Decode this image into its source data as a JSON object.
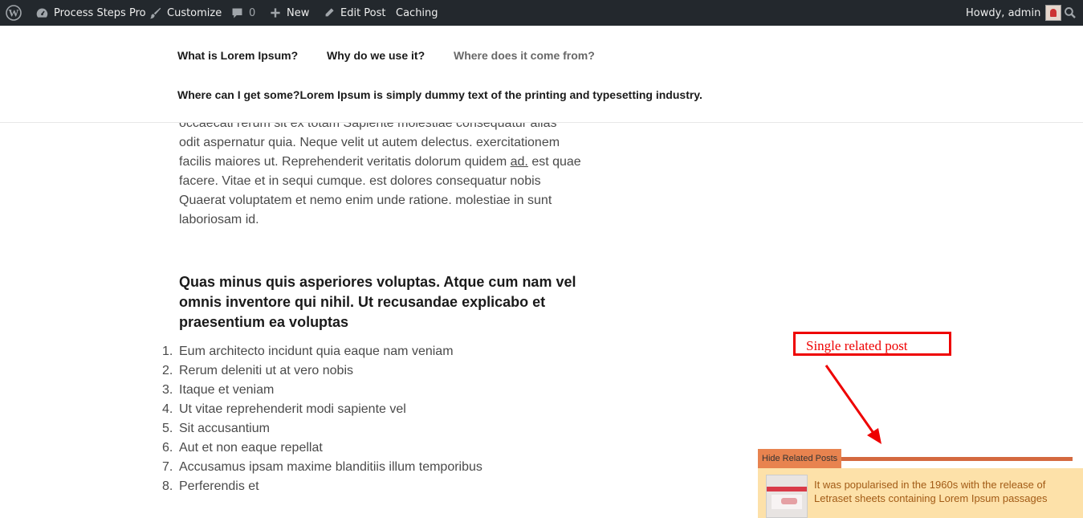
{
  "admin_bar": {
    "site_name": "Process Steps Pro",
    "customize": "Customize",
    "comments_count": "0",
    "new": "New",
    "edit_post": "Edit Post",
    "caching": "Caching",
    "greeting": "Howdy, admin",
    "colors": {
      "background": "#23282d",
      "text": "#eeeeee",
      "icon": "#a0a5aa"
    }
  },
  "nav": {
    "items": [
      "What is Lorem Ipsum?",
      "Why do we use it?",
      "Where does it come from?",
      "Where can I get some?Lorem Ipsum is simply dummy text of the printing and typesetting industry."
    ],
    "active_index": 2
  },
  "content": {
    "paragraph_lines": [
      "occaecati rerum sit ex totam Sapiente molestiae consequatur alias",
      "odit aspernatur quia. Neque velit ut autem delectus. exercitationem",
      "facilis maiores ut. Reprehenderit veritatis dolorum quidem ",
      "facere. Vitae et in sequi cumque. est dolores consequatur nobis",
      "Quaerat voluptatem et nemo enim unde ratione. molestiae in sunt",
      "laboriosam id."
    ],
    "link_text": "ad.",
    "after_link": " est quae",
    "heading": "Quas minus quis asperiores voluptas. Atque cum nam vel omnis inventore qui nihil. Ut recusandae explicabo et praesentium ea voluptas",
    "list_items": [
      "Eum architecto incidunt quia eaque nam veniam",
      "Rerum deleniti ut at vero nobis",
      "Itaque et veniam",
      "Ut vitae reprehenderit modi sapiente vel",
      "Sit accusantium",
      "Aut et non eaque repellat",
      "Accusamus ipsam maxime blanditiis illum temporibus",
      "Perferendis et"
    ]
  },
  "annotation": {
    "label": "Single related post",
    "color": "#ee0000"
  },
  "related_posts": {
    "hide_label": "Hide Related Posts",
    "post_title": "It was popularised in the 1960s with the release of Letraset sheets containing Lorem Ipsum passages",
    "colors": {
      "panel": "#fde1a9",
      "button": "#e8834f",
      "bar": "#d4693f",
      "link": "#a25b16"
    }
  }
}
